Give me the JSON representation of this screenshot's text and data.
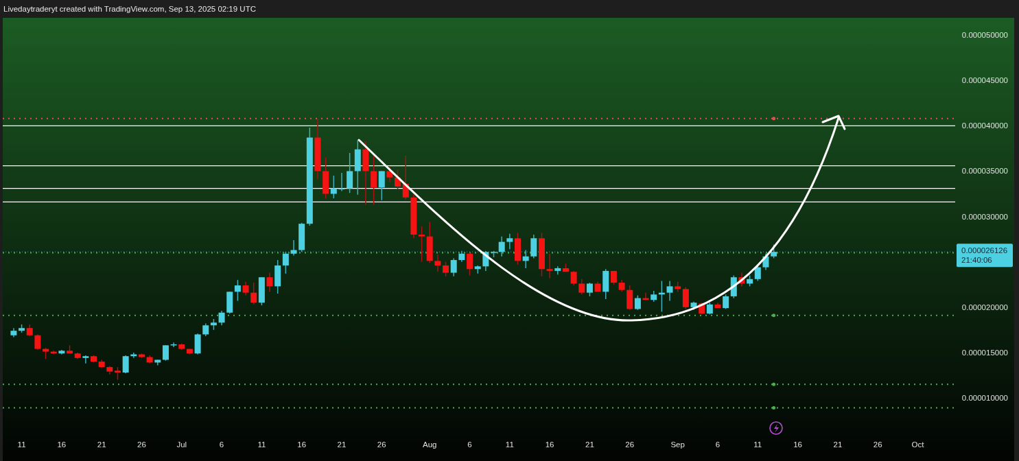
{
  "header": {
    "text": "Livedaytraderyt created with TradingView.com, Sep 13, 2025 02:19 UTC"
  },
  "chart": {
    "price_label": {
      "price": "0.000026126",
      "countdown": "21:40:06"
    },
    "price_axis": [
      "0.000050000",
      "0.000045000",
      "0.000040000",
      "0.000035000",
      "0.000030000",
      "0.000020000",
      "0.000015000",
      "0.000010000"
    ],
    "time_axis": [
      "11",
      "16",
      "21",
      "26",
      "Jul",
      "6",
      "11",
      "16",
      "21",
      "26",
      "Aug",
      "6",
      "11",
      "16",
      "21",
      "26",
      "Sep",
      "6",
      "11",
      "16",
      "21",
      "26",
      "Oct"
    ]
  }
}
